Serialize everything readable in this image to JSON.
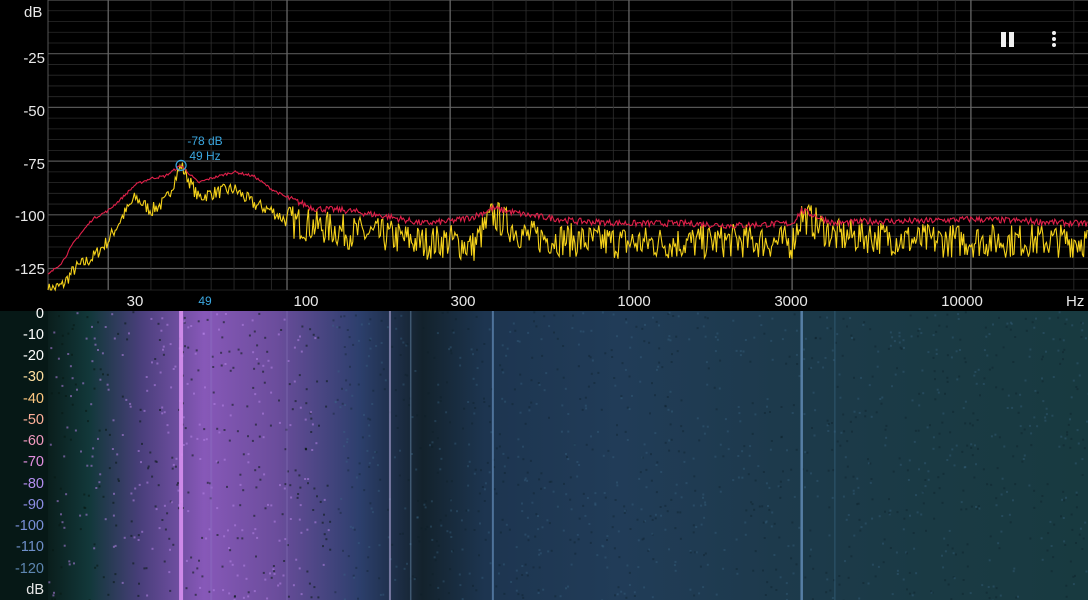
{
  "spectrum": {
    "db_unit": "dB",
    "hz_unit": "Hz",
    "db_ticks": [
      "-25",
      "-50",
      "-75",
      "-100",
      "-125"
    ],
    "freq_ticks": [
      "30",
      "100",
      "300",
      "1000",
      "3000",
      "10000"
    ],
    "peak": {
      "db_label": "-78 dB",
      "hz_label": "49 Hz",
      "axis_marker": "49"
    },
    "colors": {
      "peak_hold": "#e0204a",
      "live": "#f5d21a",
      "grid": "#3a3a3a",
      "peak_marker": "#3ba7e0"
    }
  },
  "toolbar": {
    "pause_icon": "pause-icon",
    "menu_icon": "more-vert-icon"
  },
  "spectrogram": {
    "scale_labels": [
      "0",
      "-10",
      "-20",
      "-30",
      "-40",
      "-50",
      "-60",
      "-70",
      "-80",
      "-90",
      "-100",
      "-110",
      "-120"
    ],
    "scale_colors": [
      "#ffffff",
      "#ffffff",
      "#ffffff",
      "#ffe0a0",
      "#ffc880",
      "#ffb09a",
      "#f29ac0",
      "#e38fe0",
      "#b48ef0",
      "#8e8ee6",
      "#7a90d8",
      "#6e8fc8",
      "#5d86b0"
    ],
    "unit": "dB"
  },
  "chart_data": {
    "type": "line",
    "x_scale": "log",
    "xlim": [
      20,
      22000
    ],
    "ylim": [
      -135,
      0
    ],
    "xlabel": "Hz",
    "ylabel": "dB",
    "series": [
      {
        "x": [
          20,
          22,
          24,
          27,
          30,
          33,
          36,
          40,
          44,
          49,
          55,
          60,
          70,
          80,
          90,
          100,
          120,
          150,
          200,
          250,
          300,
          350,
          400,
          500,
          700,
          1000,
          1500,
          2000,
          3000,
          3200,
          4000,
          5000,
          7000,
          10000,
          15000,
          20000,
          22000
        ],
        "y": [
          -128,
          -122,
          -112,
          -102,
          -98,
          -92,
          -86,
          -83,
          -82,
          -77,
          -85,
          -83,
          -80,
          -82,
          -88,
          -92,
          -97,
          -98,
          -101,
          -104,
          -103,
          -101,
          -97,
          -100,
          -103,
          -104,
          -104,
          -105,
          -104,
          -98,
          -104,
          -103,
          -103,
          -102,
          -103,
          -104,
          -104
        ]
      },
      {
        "x": [
          20,
          22,
          24,
          27,
          30,
          33,
          36,
          40,
          44,
          49,
          55,
          60,
          70,
          80,
          90,
          100,
          120,
          150,
          200,
          250,
          300,
          350,
          400,
          500,
          700,
          1000,
          1500,
          2000,
          3000,
          3200,
          4000,
          5000,
          7000,
          10000,
          15000,
          20000,
          22000
        ],
        "y": [
          -135,
          -133,
          -125,
          -120,
          -112,
          -101,
          -92,
          -98,
          -94,
          -77,
          -92,
          -90,
          -88,
          -95,
          -98,
          -103,
          -105,
          -108,
          -110,
          -113,
          -112,
          -115,
          -100,
          -110,
          -112,
          -113,
          -113,
          -112,
          -113,
          -100,
          -110,
          -110,
          -112,
          -112,
          -112,
          -112,
          -112
        ]
      }
    ]
  }
}
